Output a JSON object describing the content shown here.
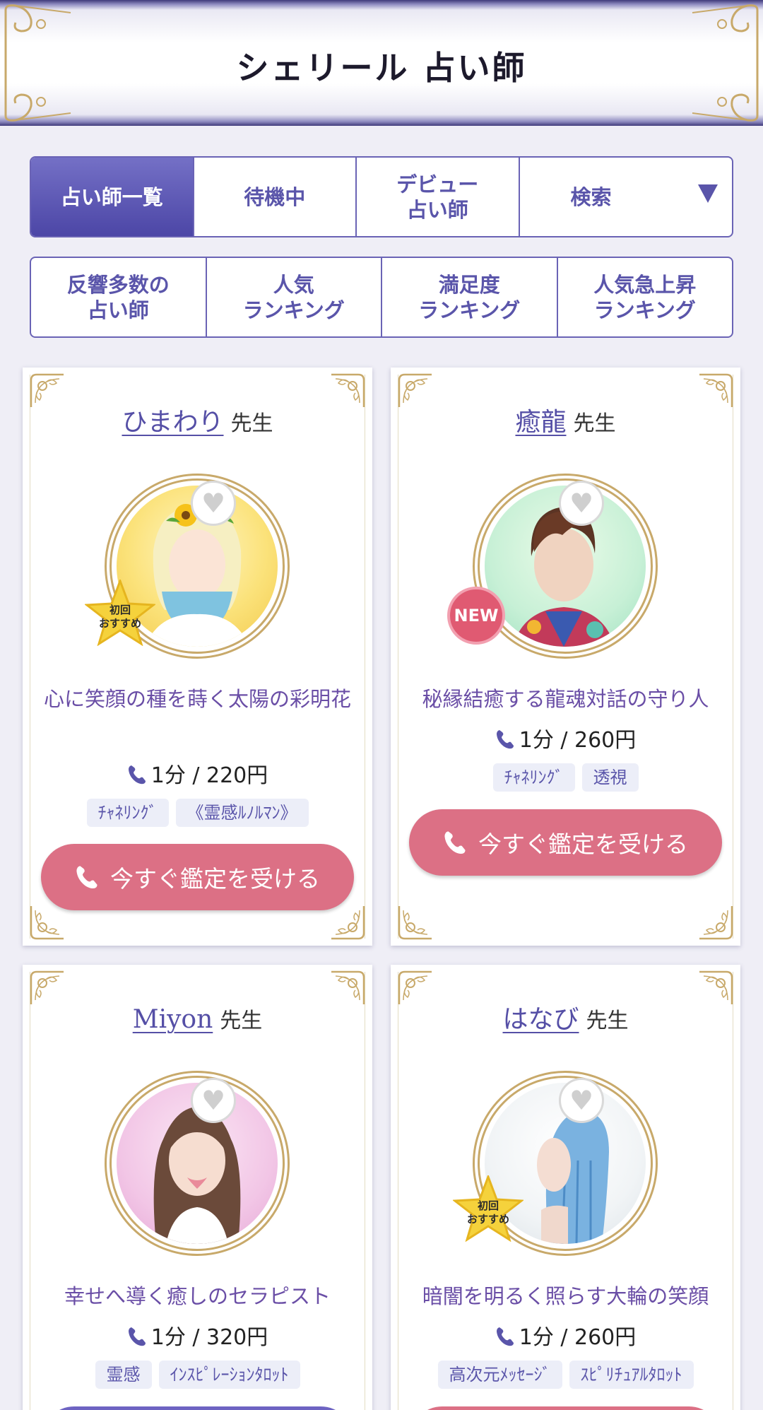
{
  "header": {
    "title": "シェリール 占い師"
  },
  "tabs_row1": [
    {
      "label": "占い師一覧",
      "active": true
    },
    {
      "label": "待機中"
    },
    {
      "label": "デビュー\n占い師"
    },
    {
      "label": "検索"
    }
  ],
  "tabs_row2": [
    {
      "label": "反響多数の\n占い師"
    },
    {
      "label": "人気\nランキング"
    },
    {
      "label": "満足度\nランキング"
    },
    {
      "label": "人気急上昇\nランキング"
    }
  ],
  "common": {
    "sensei": "先生",
    "cta": "今すぐ鑑定を受ける",
    "heart_icon": "heart-icon"
  },
  "cards": [
    {
      "name": "ひまわり",
      "catch": "心に笑顔の種を蒔く太陽の彩明花",
      "price": "1分 / 220円",
      "tags": [
        "ﾁｬﾈﾘﾝｸﾞ",
        "《霊感ﾙﾉﾙﾏﾝ》"
      ],
      "badge": "初回\nおすすめ"
    },
    {
      "name": "癒龍",
      "catch": "秘縁結癒する龍魂対話の守り人",
      "price": "1分 / 260円",
      "tags": [
        "ﾁｬﾈﾘﾝｸﾞ",
        "透視"
      ],
      "badge": "NEW"
    },
    {
      "name": "Miyon",
      "catch": "幸せへ導く癒しのセラピスト",
      "price": "1分 / 320円",
      "tags": [
        "霊感",
        "ｲﾝｽﾋﾟﾚｰｼｮﾝﾀﾛｯﾄ"
      ]
    },
    {
      "name": "はなび",
      "catch": "暗闇を明るく照らす大輪の笑顔",
      "price": "1分 / 260円",
      "tags": [
        "高次元ﾒｯｾｰｼﾞ",
        "ｽﾋﾟﾘﾁｭｱﾙﾀﾛｯﾄ"
      ],
      "badge": "初回\nおすすめ"
    }
  ],
  "colors": {
    "accent": "#5a55aa",
    "cta": "#dc7085",
    "gold": "#c8a96a"
  }
}
